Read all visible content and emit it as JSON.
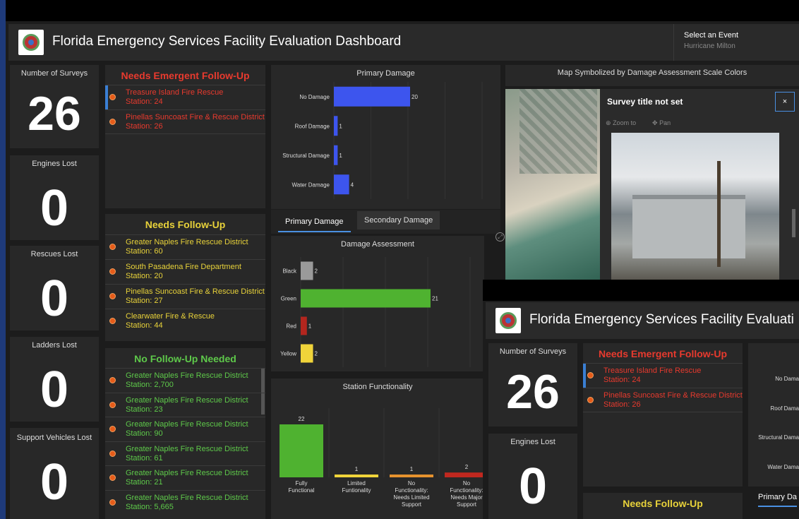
{
  "header": {
    "title": "Florida Emergency Services Facility Evaluation Dashboard",
    "event_label": "Select an Event",
    "event_value": "Hurricane Milton"
  },
  "kpis": [
    {
      "label": "Number of Surveys",
      "value": "26"
    },
    {
      "label": "Engines Lost",
      "value": "0"
    },
    {
      "label": "Rescues Lost",
      "value": "0"
    },
    {
      "label": "Ladders Lost",
      "value": "0"
    },
    {
      "label": "Support Vehicles Lost",
      "value": "0"
    }
  ],
  "emergent": {
    "title": "Needs Emergent Follow-Up",
    "items": [
      {
        "name": "Treasure Island Fire Rescue",
        "station": "Station: 24"
      },
      {
        "name": "Pinellas Suncoast Fire & Rescue District",
        "station": "Station: 26"
      }
    ]
  },
  "followup": {
    "title": "Needs Follow-Up",
    "items": [
      {
        "name": "Greater Naples Fire Rescue District",
        "station": "Station: 60"
      },
      {
        "name": "South Pasadena Fire Department",
        "station": "Station: 20"
      },
      {
        "name": "Pinellas Suncoast Fire & Rescue District",
        "station": "Station: 27"
      },
      {
        "name": "Clearwater Fire & Rescue",
        "station": "Station: 44"
      }
    ]
  },
  "nofollow": {
    "title": "No Follow-Up Needed",
    "items": [
      {
        "name": "Greater Naples Fire Rescue District",
        "station": "Station: 2,700"
      },
      {
        "name": "Greater Naples Fire Rescue District",
        "station": "Station: 23"
      },
      {
        "name": "Greater Naples Fire Rescue District",
        "station": "Station: 90"
      },
      {
        "name": "Greater Naples Fire Rescue District",
        "station": "Station: 61"
      },
      {
        "name": "Greater Naples Fire Rescue District",
        "station": "Station: 21"
      },
      {
        "name": "Greater Naples Fire Rescue District",
        "station": "Station: 5,665"
      }
    ]
  },
  "tabs": {
    "primary": "Primary Damage",
    "secondary": "Secondary Damage"
  },
  "map": {
    "title": "Map Symbolized by Damage Assessment Scale Colors",
    "popup_title": "Survey title not set",
    "popup_close": "×",
    "zoom_to": "Zoom to",
    "pan": "Pan"
  },
  "chart_data": [
    {
      "type": "bar",
      "orientation": "horizontal",
      "title": "Primary Damage",
      "categories": [
        "No Damage",
        "Roof Damage",
        "Structural Damage",
        "Water Damage"
      ],
      "values": [
        20,
        1,
        1,
        4
      ],
      "colors": [
        "#3d55ee",
        "#3d55ee",
        "#3d55ee",
        "#3d55ee"
      ]
    },
    {
      "type": "bar",
      "orientation": "horizontal",
      "title": "Damage Assessment",
      "categories": [
        "Black",
        "Green",
        "Red",
        "Yellow"
      ],
      "values": [
        2,
        21,
        1,
        2
      ],
      "colors": [
        "#9a9a9a",
        "#4fb230",
        "#b3261e",
        "#f0d43a"
      ]
    },
    {
      "type": "bar",
      "orientation": "vertical",
      "title": "Station Functionality",
      "categories": [
        "Fully Functional",
        "Limited Funtionality",
        "No Functionality: Needs Limited Support",
        "No Functionality: Needs Major Support"
      ],
      "values": [
        22,
        1,
        1,
        2
      ],
      "colors": [
        "#4fb230",
        "#f0d43a",
        "#e6922e",
        "#c0281f"
      ]
    }
  ],
  "overlay": {
    "title": "Florida Emergency Services Facility Evaluati",
    "kpi_label": "Number of Surveys",
    "kpi_value": "26",
    "kpi2_label": "Engines Lost",
    "kpi2_value": "0",
    "emergent_title": "Needs Emergent Follow-Up",
    "emergent_items": [
      {
        "name": "Treasure Island Fire Rescue",
        "station": "Station: 24"
      },
      {
        "name": "Pinellas Suncoast Fire & Rescue District",
        "station": "Station: 26"
      }
    ],
    "followup_title": "Needs Follow-Up",
    "chart_labels": [
      "No Dama",
      "Roof Dama",
      "Structural Dama",
      "Water Dama"
    ],
    "tab": "Primary Da"
  }
}
